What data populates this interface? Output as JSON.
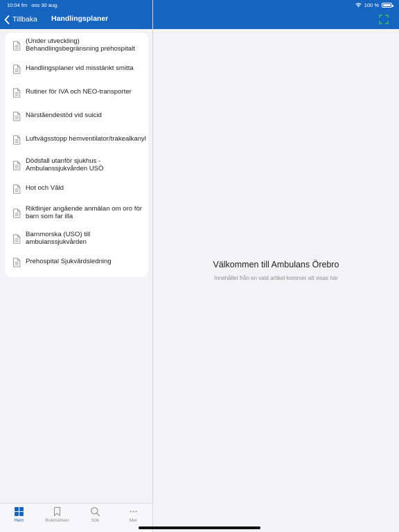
{
  "status": {
    "time": "10:04 fm",
    "date": "ons 30 aug.",
    "battery": "100 %"
  },
  "nav": {
    "back_label": "Tillbaka",
    "title": "Handlingsplaner"
  },
  "list": [
    {
      "label": "(Under utveckling)\nBehandlingsbegränsning prehospitalt"
    },
    {
      "label": "Handlingsplaner vid misstänkt smitta"
    },
    {
      "label": "Rutiner för IVA och NEO-transporter"
    },
    {
      "label": "Närståendestöd vid suicid"
    },
    {
      "label": "Luftvägsstopp hemventilator/trakealkanyl"
    },
    {
      "label": "Dödsfall utanför sjukhus -\nAmbulanssjukvården USÖ"
    },
    {
      "label": "Hot och Våld"
    },
    {
      "label": "Riktlinjer angående anmälan om oro för\nbarn som far illa"
    },
    {
      "label": "Barnmorska (USÖ) till\nambulanssjukvården"
    },
    {
      "label": "Prehospital Sjukvårdsledning"
    }
  ],
  "detail": {
    "title": "Välkommen till Ambulans Örebro",
    "subtitle": "Innehållet från en vald artikel kommer att visas här"
  },
  "tabs": [
    {
      "label": "Hem",
      "icon": "home-grid-icon",
      "active": true
    },
    {
      "label": "Bokmärken",
      "icon": "bookmark-icon",
      "active": false
    },
    {
      "label": "Sök",
      "icon": "search-icon",
      "active": false
    },
    {
      "label": "Mer",
      "icon": "more-icon",
      "active": false
    }
  ],
  "colors": {
    "accent": "#1565c0",
    "expand_icon": "#34c759"
  }
}
